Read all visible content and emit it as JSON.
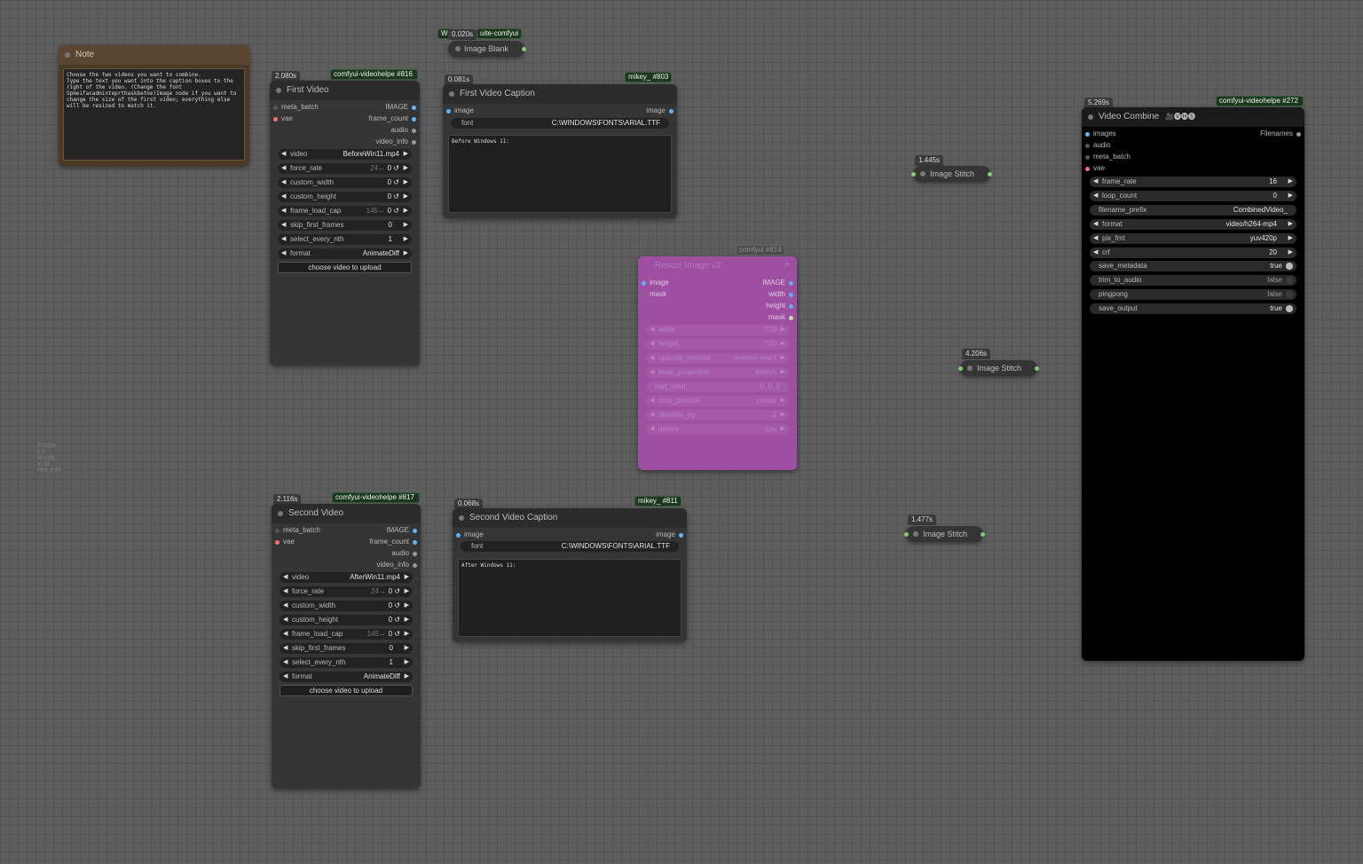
{
  "note": {
    "title": "Note",
    "text": "Choose the two videos you want to combine.\nType the text you want into the caption boxes to the right of the video. (Change the font Spmeifacadminteprthaskbetne)Image node if you want to change the size of the first video; everything else will be resized to match it."
  },
  "image_blank": {
    "time": "0.020s",
    "tag_short": "W:",
    "tag": "uite-comfyui",
    "title": "Image Blank"
  },
  "first_video": {
    "time": "2.080s",
    "tag": "comfyui-videohelpe #816",
    "title": "First Video",
    "inputs": [
      "meta_batch",
      "vae"
    ],
    "outputs": [
      "IMAGE",
      "frame_count",
      "audio",
      "video_info"
    ],
    "widgets": [
      {
        "name": "video",
        "value": "BeforeWin11.mp4"
      },
      {
        "name": "force_rate",
        "hint": "24↔",
        "value": "0 ↺"
      },
      {
        "name": "custom_width",
        "value": "0 ↺"
      },
      {
        "name": "custom_height",
        "value": "0 ↺"
      },
      {
        "name": "frame_load_cap",
        "hint": "145↔",
        "value": "0 ↺"
      },
      {
        "name": "skip_first_frames",
        "value": "0"
      },
      {
        "name": "select_every_nth",
        "value": "1"
      },
      {
        "name": "format",
        "value": "AnimateDiff"
      }
    ],
    "upload_label": "choose video to upload"
  },
  "first_caption": {
    "time": "0.081s",
    "tag": "mikey_ #803",
    "title": "First Video Caption",
    "input": "image",
    "output": "image",
    "font_label": "font",
    "font_value": "C:\\WINDOWS\\FONTS\\ARIAL.TTF",
    "text": "Before Windows 11:"
  },
  "second_video": {
    "time": "2.116s",
    "tag": "comfyui-videohelpe #817",
    "title": "Second Video",
    "inputs": [
      "meta_batch",
      "vae"
    ],
    "outputs": [
      "IMAGE",
      "frame_count",
      "audio",
      "video_info"
    ],
    "widgets": [
      {
        "name": "video",
        "value": "AfterWin11.mp4"
      },
      {
        "name": "force_rate",
        "hint": "24↔",
        "value": "0 ↺"
      },
      {
        "name": "custom_width",
        "value": "0 ↺"
      },
      {
        "name": "custom_height",
        "value": "0 ↺"
      },
      {
        "name": "frame_load_cap",
        "hint": "145↔",
        "value": "0 ↺"
      },
      {
        "name": "skip_first_frames",
        "value": "0"
      },
      {
        "name": "select_every_nth",
        "value": "1"
      },
      {
        "name": "format",
        "value": "AnimateDiff"
      }
    ],
    "upload_label": "choose video to upload"
  },
  "second_caption": {
    "time": "0.068s",
    "tag": "mikey_ #811",
    "title": "Second Video Caption",
    "input": "image",
    "output": "image",
    "font_label": "font",
    "font_value": "C:\\WINDOWS\\FONTS\\ARIAL.TTF",
    "text": "After Windows 11:"
  },
  "resize": {
    "tag": "comfyui #814",
    "title": "Resize Image v2",
    "inputs": [
      "image",
      "mask"
    ],
    "outputs": [
      "IMAGE",
      "width",
      "height",
      "mask"
    ],
    "widgets": [
      {
        "name": "width",
        "value": "720"
      },
      {
        "name": "height",
        "value": "720"
      },
      {
        "name": "upscale_method",
        "value": "nearest-exact"
      },
      {
        "name": "keep_proportion",
        "value": "stretch"
      },
      {
        "name": "pad_color",
        "value": "0, 0, 0"
      },
      {
        "name": "crop_position",
        "value": "center"
      },
      {
        "name": "divisible_by",
        "value": "2"
      },
      {
        "name": "device",
        "value": "cpu"
      }
    ]
  },
  "stitch1": {
    "time": "1.445s",
    "title": "Image Stitch"
  },
  "stitch2": {
    "time": "4.206s",
    "title": "Image Stitch"
  },
  "stitch3": {
    "time": "1.477s",
    "title": "Image Stitch"
  },
  "video_combine": {
    "time": "5.269s",
    "tag": "comfyui-videohelpe #272",
    "title": "Video Combine",
    "title_icons": "🎥🅥🅗🅢",
    "inputs": [
      "images",
      "audio",
      "meta_batch",
      "vae"
    ],
    "output": "Filenames",
    "widgets": [
      {
        "name": "frame_rate",
        "value": "16",
        "type": "number"
      },
      {
        "name": "loop_count",
        "value": "0",
        "type": "number"
      },
      {
        "name": "filename_prefix",
        "value": "CombinedVideo_",
        "type": "text"
      },
      {
        "name": "format",
        "value": "video/h264-mp4",
        "type": "combo"
      },
      {
        "name": "pix_fmt",
        "value": "yuv420p",
        "type": "combo"
      },
      {
        "name": "crf",
        "value": "20",
        "type": "number"
      },
      {
        "name": "save_metadata",
        "value": "true",
        "type": "toggle"
      },
      {
        "name": "trim_to_audio",
        "value": "false",
        "type": "toggle"
      },
      {
        "name": "pingpong",
        "value": "false",
        "type": "toggle"
      },
      {
        "name": "save_output",
        "value": "true",
        "type": "toggle"
      }
    ]
  },
  "stats": {
    "lines": [
      "T: 0.00s",
      "I: 0",
      "N: 0 [0]",
      "V: 22",
      "FPS: 0.00"
    ]
  },
  "colors": {
    "canvas": "#5d5d5d",
    "node_body": "#353535",
    "node_title": "#2b2b2b",
    "note_body": "#4b3a26",
    "resize_node": "#a24fa6",
    "tag_bg": "#1d3620",
    "pin_image": "#64b5f6",
    "pin_vae": "#ff6e6e",
    "pin_green": "#7ad16a"
  }
}
